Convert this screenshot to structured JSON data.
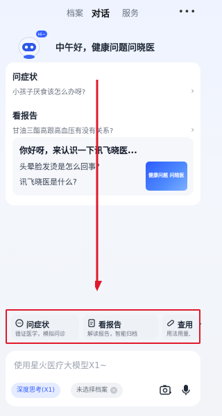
{
  "topbar": {
    "tabs": [
      {
        "label": "档案"
      },
      {
        "label": "对话"
      },
      {
        "label": "服务"
      }
    ],
    "more_label": "•••"
  },
  "hero": {
    "badge": "Hi~",
    "greeting": "中午好，健康问题问晓医"
  },
  "sections": [
    {
      "title": "问症状",
      "subtitle": "小孩子厌食该怎么办呀?"
    },
    {
      "title": "看报告",
      "subtitle": "甘油三酯高跟高血压有没有关系?"
    }
  ],
  "intro": {
    "title": "你好呀，来认识一下讯飞晓医...",
    "questions": [
      "头晕脸发烫是怎么回事?",
      "讯飞晓医是什么?"
    ],
    "thumb_text": "健康问题 问晓医"
  },
  "shortcuts": [
    {
      "title": "问症状",
      "subtitle": "循证医学，模拟问诊"
    },
    {
      "title": "看报告",
      "subtitle": "解读报告，智能归档"
    },
    {
      "title": "查用",
      "subtitle": "用法用量,"
    }
  ],
  "composer": {
    "placeholder": "使用星火医疗大模型X1~",
    "deep_think": "深度思考(X1)",
    "archive": "未选择档案"
  },
  "colors": {
    "accent": "#3461ff",
    "highlight_border": "#e0182b",
    "arrow": "#e0182b"
  }
}
